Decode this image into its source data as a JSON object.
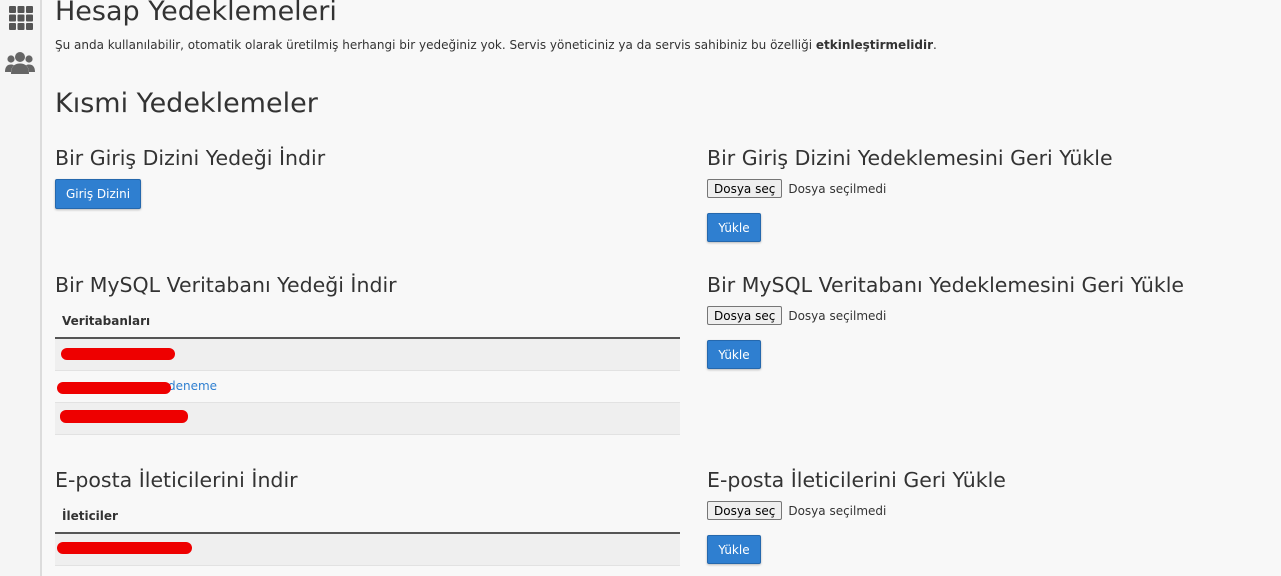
{
  "sidebar": {
    "items": [
      {
        "icon": "grid-icon"
      },
      {
        "icon": "users-icon"
      }
    ]
  },
  "page": {
    "title": "Hesap Yedeklemeleri",
    "description_text": "Şu anda kullanılabilir, otomatik olarak üretilmiş herhangi bir yedeğiniz yok. Servis yöneticiniz ya da servis sahibiniz bu özelliği ",
    "description_bold": "etkinleştirmelidir",
    "description_end": "."
  },
  "partial": {
    "title": "Kısmi Yedeklemeler",
    "home_download": {
      "title": "Bir Giriş Dizini Yedeği İndir",
      "button": "Giriş Dizini"
    },
    "home_restore": {
      "title": "Bir Giriş Dizini Yedeklemesini Geri Yükle",
      "file_button": "Dosya seç",
      "file_status": "Dosya seçilmedi",
      "upload_button": "Yükle"
    },
    "mysql_download": {
      "title": "Bir MySQL Veritabanı Yedeği İndir",
      "column_header": "Veritabanları",
      "rows": [
        {
          "visible_text": ""
        },
        {
          "visible_text": "deneme"
        },
        {
          "visible_text": ""
        }
      ]
    },
    "mysql_restore": {
      "title": "Bir MySQL Veritabanı Yedeklemesini Geri Yükle",
      "file_button": "Dosya seç",
      "file_status": "Dosya seçilmedi",
      "upload_button": "Yükle"
    },
    "email_download": {
      "title": "E-posta İleticilerini İndir",
      "column_header": "İleticiler",
      "rows": [
        {
          "visible_text": ""
        }
      ]
    },
    "email_restore": {
      "title": "E-posta İleticilerini Geri Yükle",
      "file_button": "Dosya seç",
      "file_status": "Dosya seçilmedi",
      "upload_button": "Yükle"
    }
  },
  "colors": {
    "accent": "#2f7fd0",
    "redaction": "#ee0000"
  }
}
